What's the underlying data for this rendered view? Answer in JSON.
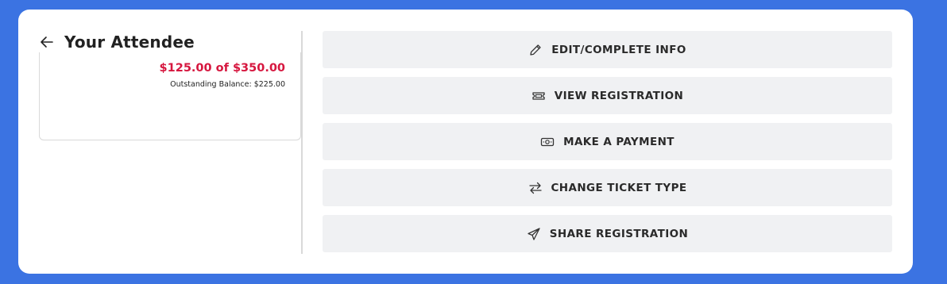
{
  "header": {
    "title": "Your Attendee",
    "back_icon": "arrow-left-icon"
  },
  "balance": {
    "amount_text": "$125.00 of $350.00",
    "outstanding_text": "Outstanding Balance: $225.00",
    "accent_color": "#d6173f"
  },
  "actions": [
    {
      "label": "EDIT/COMPLETE INFO",
      "icon": "pencil-icon"
    },
    {
      "label": "VIEW REGISTRATION",
      "icon": "ticket-icon"
    },
    {
      "label": "MAKE A PAYMENT",
      "icon": "cash-icon"
    },
    {
      "label": "CHANGE TICKET TYPE",
      "icon": "swap-arrows-icon"
    },
    {
      "label": "SHARE REGISTRATION",
      "icon": "paper-plane-icon"
    }
  ],
  "colors": {
    "background": "#3b73e2",
    "card": "#ffffff",
    "button": "#f0f1f3"
  }
}
